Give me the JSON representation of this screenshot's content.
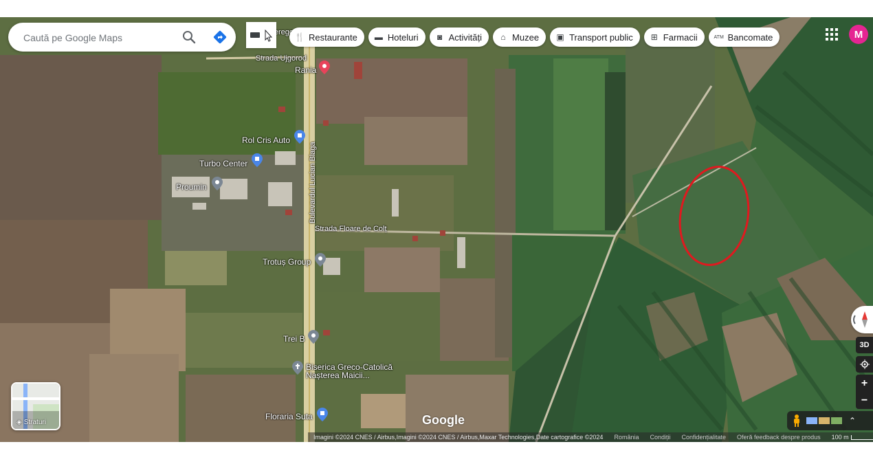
{
  "search": {
    "placeholder": "Caută pe Google Maps"
  },
  "chips": [
    {
      "label": "Restaurante",
      "icon": "fork-knife-icon"
    },
    {
      "label": "Hoteluri",
      "icon": "bed-icon"
    },
    {
      "label": "Activități",
      "icon": "camera-icon"
    },
    {
      "label": "Muzee",
      "icon": "museum-icon"
    },
    {
      "label": "Transport public",
      "icon": "train-icon"
    },
    {
      "label": "Farmacii",
      "icon": "pharmacy-icon"
    },
    {
      "label": "Bancomate",
      "icon": "atm-icon"
    }
  ],
  "account": {
    "initial": "M",
    "color": "#e52592"
  },
  "layers": {
    "label": "Straturi"
  },
  "places": [
    {
      "name": "Rania"
    },
    {
      "name": "Rol Cris Auto"
    },
    {
      "name": "Turbo Center"
    },
    {
      "name": "Proumin"
    },
    {
      "name": "Trotuș Group"
    },
    {
      "name": "Trei B"
    },
    {
      "name": "Biserica Greco-Catolică Nașterea Maicii..."
    },
    {
      "name": "Floraria Suta"
    }
  ],
  "roads": {
    "main": "Bulevardul Lucian Blaga",
    "side1": "Strada Floare de Colț",
    "top1": "Str. Beregovo",
    "top2": "Strada Ujgorod"
  },
  "footer": {
    "attribution": "Imagini ©2024 CNES / Airbus,Imagini ©2024 CNES / Airbus,Maxar Technologies,Date cartografice ©2024",
    "country": "România",
    "terms": "Condiții",
    "privacy": "Confidențialitate",
    "feedback": "Oferă feedback despre produs",
    "scale": "100 m"
  },
  "logo": "Google",
  "controls": {
    "three_d": "3D",
    "zoom_in": "+",
    "zoom_out": "−"
  },
  "annotation": {
    "shape": "ellipse",
    "color": "#e0191f"
  }
}
